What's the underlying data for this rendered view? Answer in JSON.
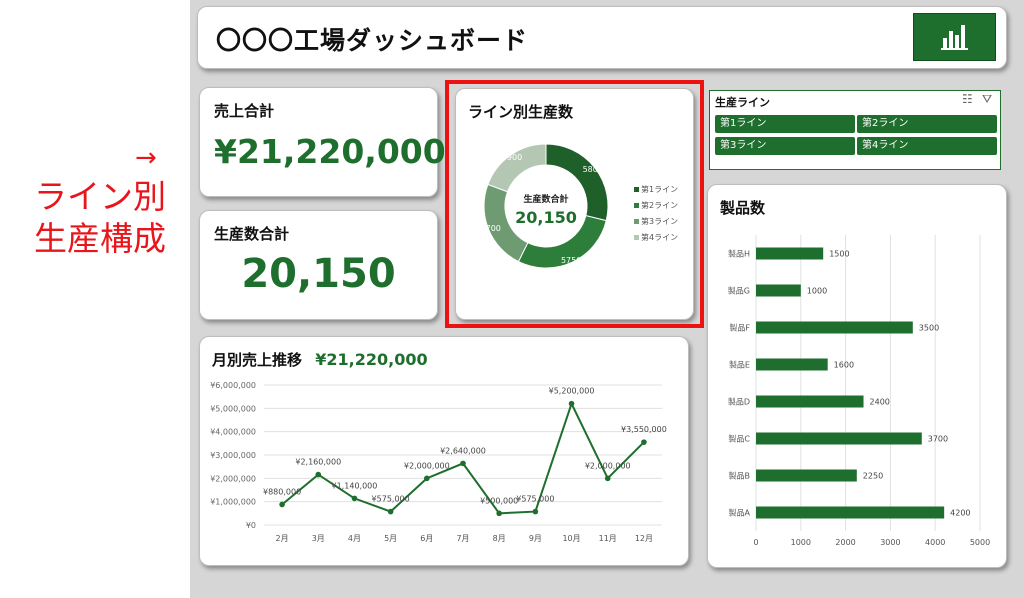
{
  "annotation": {
    "arrow": "→",
    "line1": "ライン別",
    "line2": "生産構成"
  },
  "header": {
    "title": "〇〇〇工場ダッシュボード"
  },
  "kpi": {
    "sales_title": "売上合計",
    "sales_value": "¥21,220,000",
    "production_title": "生産数合計",
    "production_value": "20,150"
  },
  "line_production": {
    "title": "ライン別生産数",
    "center_label": "生産数合計",
    "center_value": "20,150"
  },
  "slicer": {
    "title": "生産ライン",
    "items": [
      "第1ライン",
      "第2ライン",
      "第3ライン",
      "第4ライン"
    ]
  },
  "monthly_sales": {
    "title": "月別売上推移",
    "total": "¥21,220,000"
  },
  "products": {
    "title": "製品数"
  },
  "colors": {
    "accent": "#1e6e2d",
    "highlight": "#ee1111",
    "donut": [
      "#1f5f2a",
      "#2d7e3a",
      "#6f9b72",
      "#b3c7b2"
    ]
  },
  "chart_data": [
    {
      "type": "pie",
      "title": "ライン別生産数",
      "categories": [
        "第1ライン",
        "第2ライン",
        "第3ライン",
        "第4ライン"
      ],
      "values": [
        5800,
        5750,
        4700,
        3900
      ],
      "legend": "right"
    },
    {
      "type": "line",
      "title": "",
      "x": [
        "2月",
        "3月",
        "4月",
        "5月",
        "6月",
        "7月",
        "8月",
        "9月",
        "10月",
        "11月",
        "12月"
      ],
      "values": [
        880000,
        2160000,
        1140000,
        575000,
        2000000,
        2640000,
        500000,
        575000,
        5200000,
        2000000,
        3550000
      ],
      "labels": [
        "¥880,000",
        "¥2,160,000",
        "¥1,140,000",
        "¥575,000",
        "¥2,000,000",
        "¥2,640,000",
        "¥500,000",
        "¥575,000",
        "¥5,200,000",
        "¥2,000,000",
        "¥3,550,000"
      ],
      "yticks": [
        "¥0",
        "¥1,000,000",
        "¥2,000,000",
        "¥3,000,000",
        "¥4,000,000",
        "¥5,000,000",
        "¥6,000,000"
      ],
      "ylim": [
        0,
        6000000
      ],
      "grid": true
    },
    {
      "type": "bar",
      "orientation": "horizontal",
      "title": "製品数",
      "categories": [
        "製品H",
        "製品G",
        "製品F",
        "製品E",
        "製品D",
        "製品C",
        "製品B",
        "製品A"
      ],
      "values": [
        1500,
        1000,
        3500,
        1600,
        2400,
        3700,
        2250,
        4200
      ],
      "xticks": [
        "0",
        "1000",
        "2000",
        "3000",
        "4000",
        "5000"
      ],
      "xlim": [
        0,
        5000
      ],
      "grid": true
    }
  ]
}
